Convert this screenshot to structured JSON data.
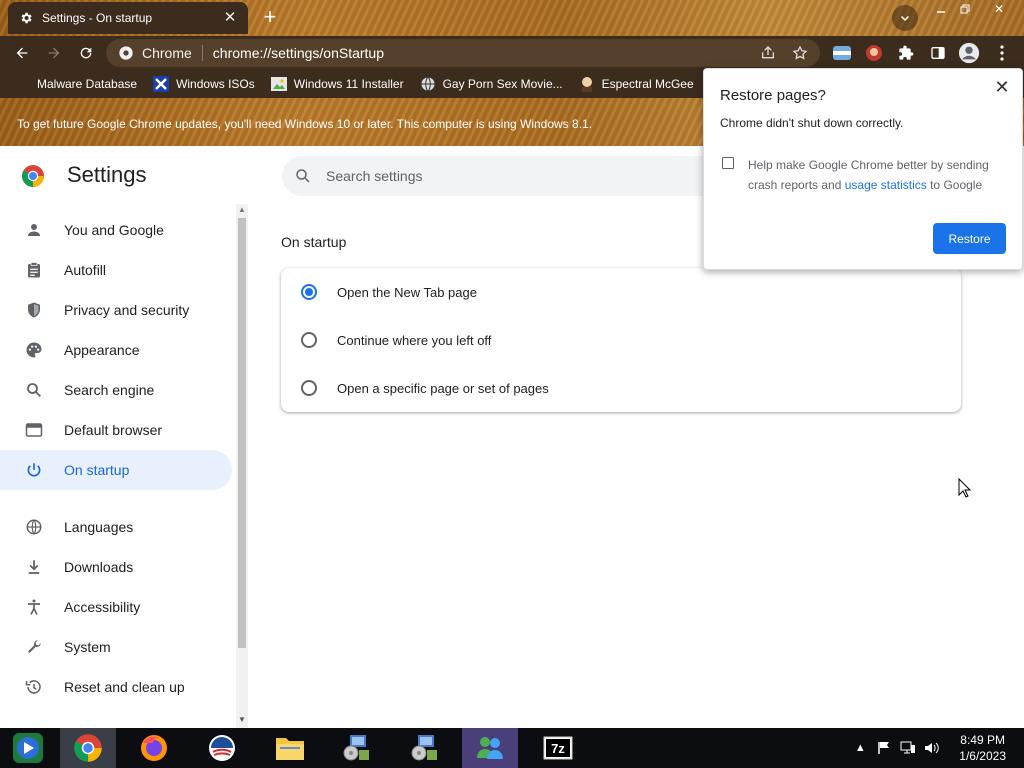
{
  "browser": {
    "tab_title": "Settings - On startup",
    "omnibox_chip": "Chrome",
    "url": "chrome://settings/onStartup",
    "bookmarks": [
      {
        "label": "Malware Database",
        "icon": "page-icon"
      },
      {
        "label": "Windows ISOs",
        "icon": "x-logo-icon"
      },
      {
        "label": "Windows 11 Installer",
        "icon": "image-icon"
      },
      {
        "label": "Gay Porn Sex Movie...",
        "icon": "globe-icon"
      },
      {
        "label": "Espectral McGee",
        "icon": "avatar-icon"
      }
    ],
    "infobar_text": "To get future Google Chrome updates, you'll need Windows 10 or later. This computer is using Windows 8.1."
  },
  "settings": {
    "title": "Settings",
    "search_placeholder": "Search settings",
    "nav": [
      {
        "label": "You and Google",
        "icon": "person-icon"
      },
      {
        "label": "Autofill",
        "icon": "clipboard-icon"
      },
      {
        "label": "Privacy and security",
        "icon": "shield-icon"
      },
      {
        "label": "Appearance",
        "icon": "palette-icon"
      },
      {
        "label": "Search engine",
        "icon": "search-icon"
      },
      {
        "label": "Default browser",
        "icon": "browser-icon"
      },
      {
        "label": "On startup",
        "icon": "power-icon",
        "active": true
      },
      {
        "label": "Languages",
        "icon": "globe-icon"
      },
      {
        "label": "Downloads",
        "icon": "download-icon"
      },
      {
        "label": "Accessibility",
        "icon": "accessibility-icon"
      },
      {
        "label": "System",
        "icon": "wrench-icon"
      },
      {
        "label": "Reset and clean up",
        "icon": "history-icon"
      }
    ],
    "section_title": "On startup",
    "startup_options": [
      {
        "label": "Open the New Tab page",
        "checked": true
      },
      {
        "label": "Continue where you left off",
        "checked": false
      },
      {
        "label": "Open a specific page or set of pages",
        "checked": false
      }
    ]
  },
  "popup": {
    "title": "Restore pages?",
    "message": "Chrome didn't shut down correctly.",
    "checkbox_text_before": "Help make Google Chrome better by sending crash reports and ",
    "checkbox_link": "usage statistics",
    "checkbox_text_after": " to Google",
    "checkbox_checked": false,
    "restore_label": "Restore"
  },
  "taskbar": {
    "apps": [
      "windows-media-center-icon",
      "chrome-icon",
      "firefox-icon",
      "obama-logo-icon",
      "file-explorer-icon",
      "installer-icon",
      "installer-icon",
      "messenger-icon",
      "7zip-icon"
    ],
    "time": "8:49 PM",
    "date": "1/6/2023"
  },
  "colors": {
    "frame": "#3b2c1d",
    "accent": "#1a73e8",
    "active_nav_bg": "#e8f0fe",
    "taskbar": "#0b0d10"
  }
}
